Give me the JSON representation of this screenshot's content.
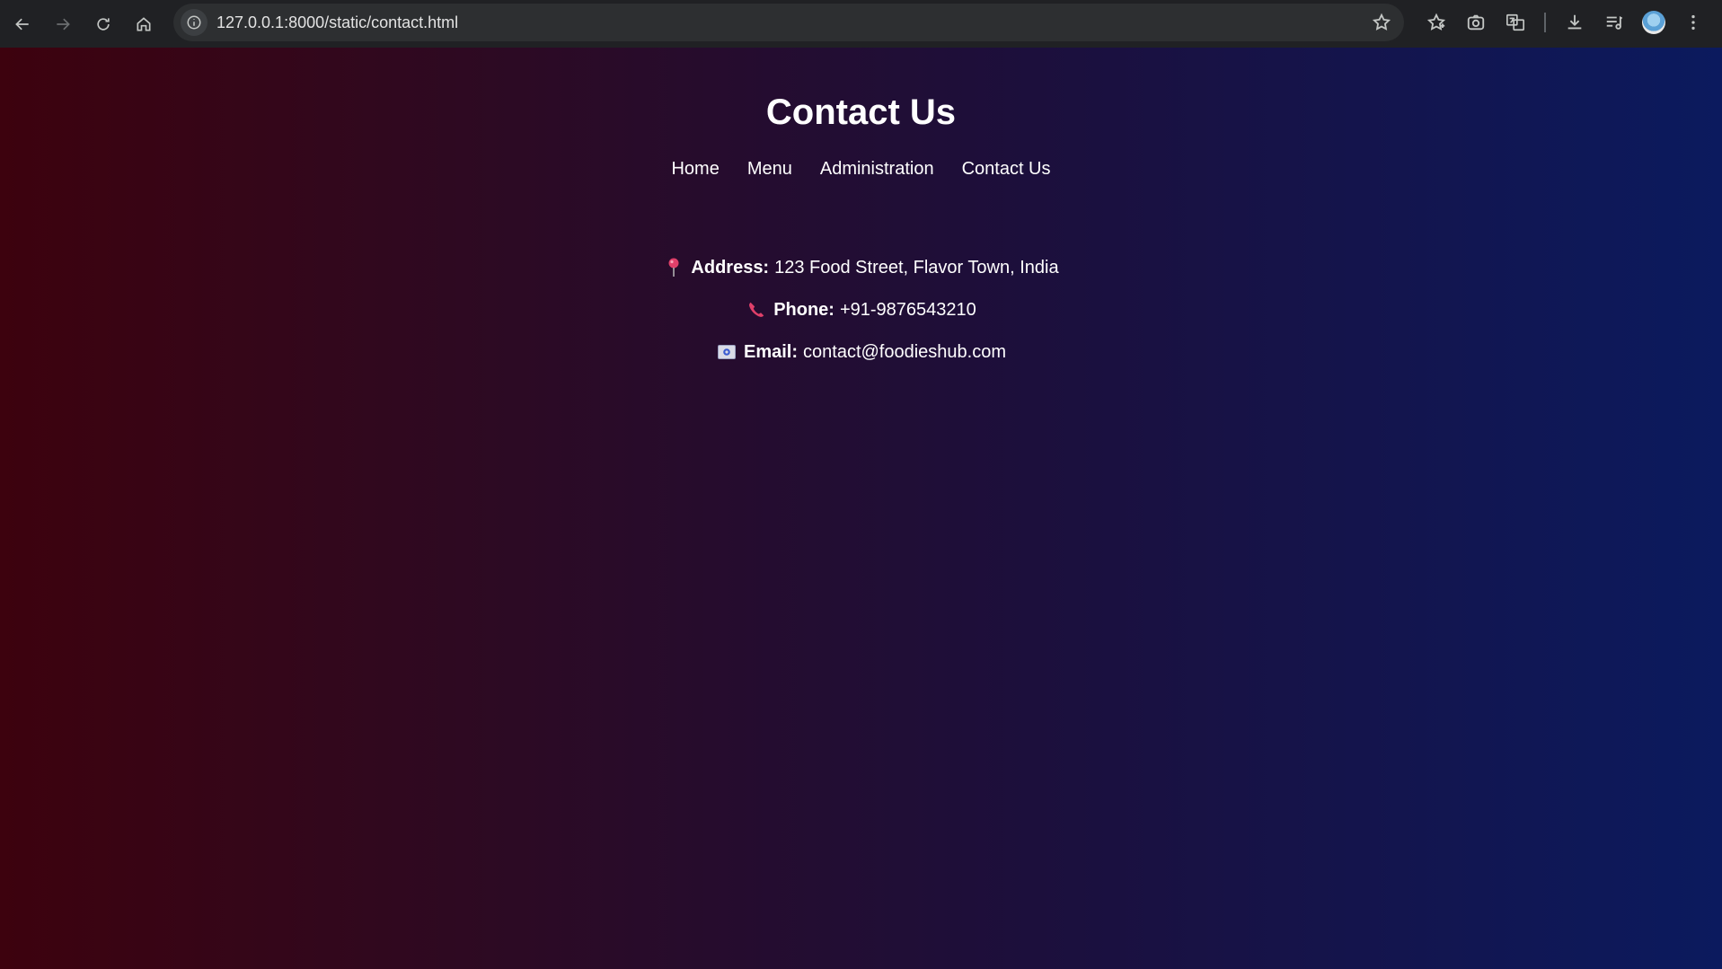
{
  "browser": {
    "url": "127.0.0.1:8000/static/contact.html",
    "icons": [
      "back-icon",
      "forward-icon",
      "reload-icon",
      "home-icon",
      "site-info-icon",
      "bookmark-star-icon",
      "extensions-icon",
      "screenshot-icon",
      "translate-icon",
      "download-icon",
      "media-queue-icon",
      "profile-avatar",
      "more-menu-icon"
    ]
  },
  "page": {
    "title": "Contact Us",
    "nav": [
      {
        "label": "Home"
      },
      {
        "label": "Menu"
      },
      {
        "label": "Administration"
      },
      {
        "label": "Contact Us"
      }
    ],
    "contact": {
      "address_label": "Address:",
      "address_value": "123 Food Street, Flavor Town, India",
      "phone_label": "Phone:",
      "phone_value": "+91-9876543210",
      "email_label": "Email:",
      "email_value": "contact@foodieshub.com"
    },
    "colors": {
      "gradient_start": "#3d020e",
      "gradient_end": "#0b1a5e",
      "icon_accent": "#e0406a"
    }
  }
}
